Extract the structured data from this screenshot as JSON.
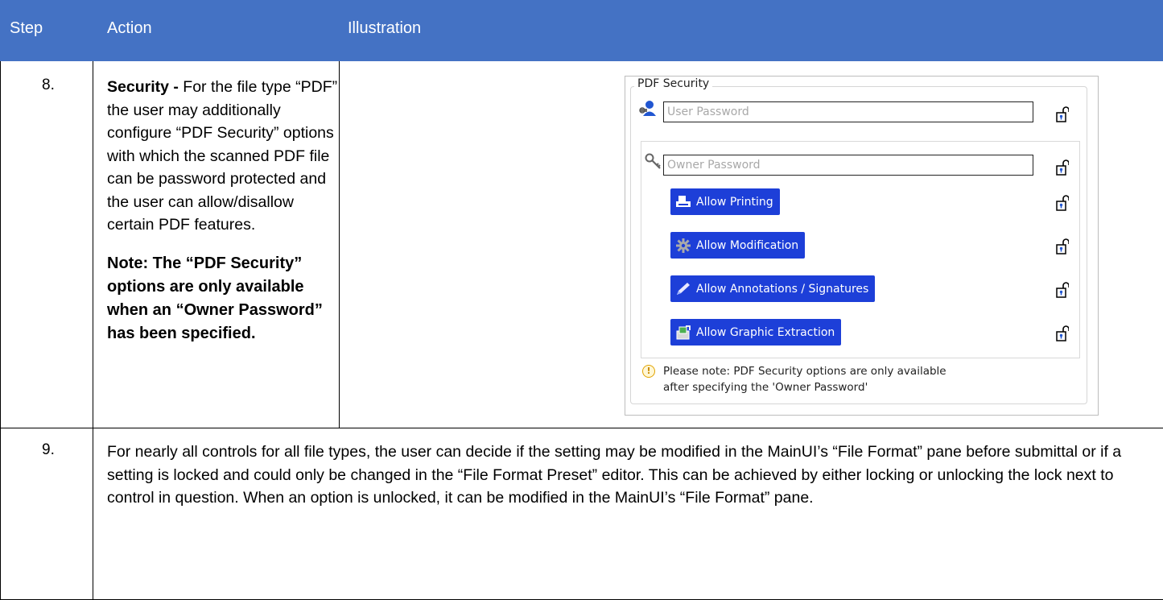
{
  "header": {
    "step": "Step",
    "action": "Action",
    "illustration": "Illustration"
  },
  "rows": [
    {
      "step": "8.",
      "action_title": "Security -",
      "action_text": " For the file type “PDF” the user may additionally configure “PDF Security” options with which the scanned PDF file can be password protected and the user can allow/disallow certain PDF features.",
      "note": "Note: The “PDF Security” options are only available when an “Owner Password” has been specified."
    },
    {
      "step": "9.",
      "text": "For nearly all controls for all file types, the user can decide if the setting may be modified in the MainUI’s “File Format” pane before submittal or if a setting is locked and could only be changed in the “File Format Preset” editor. This can be achieved by either locking or unlocking the lock next to control in question. When an option is unlocked, it can be modified in the MainUI’s “File Format” pane."
    }
  ],
  "illustration": {
    "group_title": "PDF Security",
    "user_password_placeholder": "User Password",
    "owner_password_placeholder": "Owner Password",
    "toggles": [
      {
        "label": "Allow Printing",
        "icon": "printer-icon"
      },
      {
        "label": "Allow Modification",
        "icon": "gear-icon"
      },
      {
        "label": "Allow Annotations / Signatures",
        "icon": "pen-icon"
      },
      {
        "label": "Allow Graphic Extraction",
        "icon": "extract-icon"
      }
    ],
    "notice_line1": "Please note: PDF Security options are only available",
    "notice_line2": "after specifying the 'Owner Password'",
    "notice_icon": "!",
    "colors": {
      "header_bg": "#4472c4",
      "toggle_bg": "#1d3fd8"
    }
  }
}
